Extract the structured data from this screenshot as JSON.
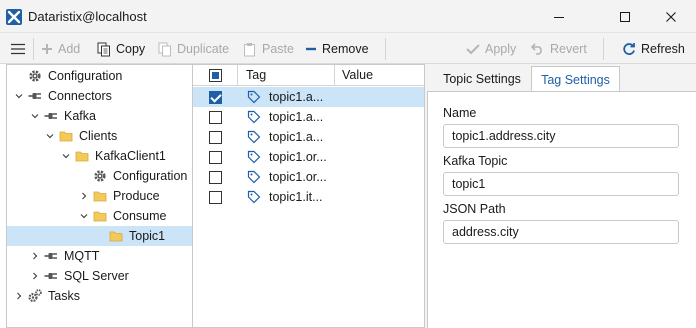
{
  "window": {
    "title": "Dataristix@localhost",
    "accent": "#1f5fa8",
    "minimize_glyph": "─",
    "maximize_glyph": "☐",
    "close_glyph": "✕"
  },
  "toolbar": {
    "add_label": "Add",
    "copy_label": "Copy",
    "duplicate_label": "Duplicate",
    "paste_label": "Paste",
    "remove_label": "Remove",
    "apply_label": "Apply",
    "revert_label": "Revert",
    "refresh_label": "Refresh"
  },
  "tree": {
    "items": [
      {
        "label": "Configuration",
        "icon": "gear-icon"
      },
      {
        "label": "Connectors",
        "icon": "plug-icon"
      },
      {
        "label": "Kafka",
        "icon": "plug-icon"
      },
      {
        "label": "Clients",
        "icon": "folder-icon"
      },
      {
        "label": "KafkaClient1",
        "icon": "folder-icon"
      },
      {
        "label": "Configuration",
        "icon": "gear-icon"
      },
      {
        "label": "Produce",
        "icon": "folder-icon"
      },
      {
        "label": "Consume",
        "icon": "folder-icon"
      },
      {
        "label": "Topic1",
        "icon": "folder-icon",
        "selected": true
      },
      {
        "label": "MQTT",
        "icon": "plug-icon"
      },
      {
        "label": "SQL Server",
        "icon": "plug-icon"
      },
      {
        "label": "Tasks",
        "icon": "gears-icon"
      }
    ]
  },
  "grid": {
    "headers": {
      "tag": "Tag",
      "value": "Value"
    },
    "rows": [
      {
        "tag": "topic1.a...",
        "checked": true,
        "selected": true
      },
      {
        "tag": "topic1.a...",
        "checked": false
      },
      {
        "tag": "topic1.a...",
        "checked": false
      },
      {
        "tag": "topic1.or...",
        "checked": false
      },
      {
        "tag": "topic1.or...",
        "checked": false
      },
      {
        "tag": "topic1.it...",
        "checked": false
      }
    ]
  },
  "settings": {
    "tabs": [
      {
        "label": "Topic Settings",
        "active": false
      },
      {
        "label": "Tag Settings",
        "active": true
      }
    ],
    "fields": {
      "name": {
        "label": "Name",
        "value": "topic1.address.city"
      },
      "kafka_topic": {
        "label": "Kafka Topic",
        "value": "topic1"
      },
      "json_path": {
        "label": "JSON Path",
        "value": "address.city"
      }
    }
  }
}
